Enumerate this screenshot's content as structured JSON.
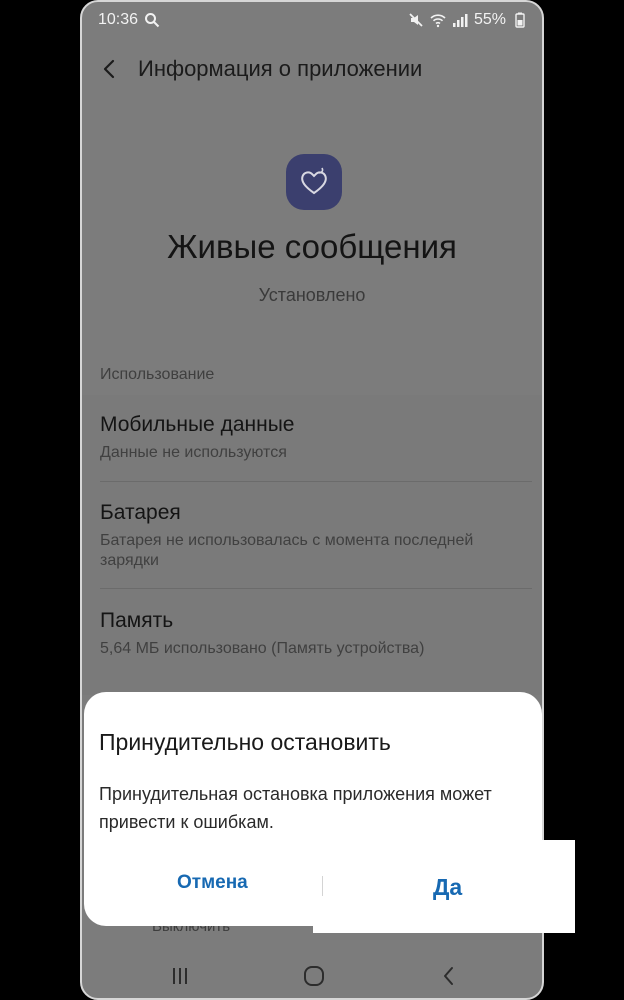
{
  "status_bar": {
    "time": "10:36",
    "battery": "55%"
  },
  "header": {
    "title": "Информация о приложении"
  },
  "app": {
    "name": "Живые сообщения",
    "status": "Установлено",
    "icon_color": "#3b3f6e"
  },
  "usage": {
    "section_label": "Использование",
    "items": [
      {
        "title": "Мобильные данные",
        "subtitle": "Данные не используются"
      },
      {
        "title": "Батарея",
        "subtitle": "Батарея не использовалась с момента последней зарядки"
      },
      {
        "title": "Память",
        "subtitle": "5,64 МБ использовано (Память устройства)"
      }
    ]
  },
  "behind_dialog_text": "Выключить",
  "dialog": {
    "title": "Принудительно остановить",
    "body": "Принудительная остановка приложения может привести к ошибкам.",
    "cancel_label": "Отмена",
    "confirm_label": "Да",
    "accent_color": "#1769b2"
  }
}
